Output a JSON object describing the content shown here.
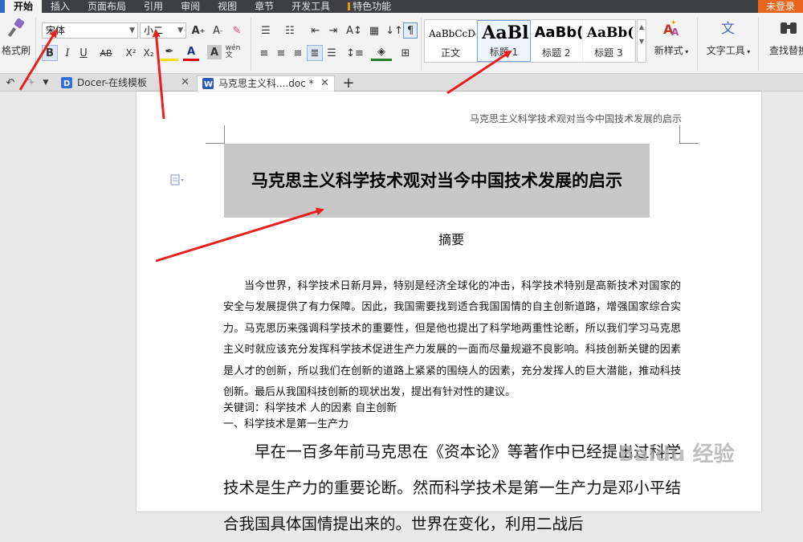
{
  "menubar": {
    "items": [
      "开始",
      "插入",
      "页面布局",
      "引用",
      "审阅",
      "视图",
      "章节",
      "开发工具",
      "特色功能"
    ],
    "login": "未登录"
  },
  "ribbon": {
    "format_painter": "格式刷",
    "font_name": "宋体",
    "font_size": "小二",
    "styles": [
      {
        "sample": "AaBbCcDd",
        "label": "正文"
      },
      {
        "sample": "AaBl",
        "label": "标题 1"
      },
      {
        "sample": "AaBb(",
        "label": "标题 2"
      },
      {
        "sample": "AaBb(",
        "label": "标题 3"
      }
    ],
    "new_style": "新样式",
    "text_tool": "文字工具",
    "find_replace": "查找替换"
  },
  "tabs": [
    {
      "label": "Docer-在线模板",
      "icon": "docer-icon"
    },
    {
      "label": "马克思主义科....doc *",
      "icon": "word-doc-icon"
    }
  ],
  "document": {
    "header": "马克思主义科学技术观对当今中国技术发展的启示",
    "title": "马克思主义科学技术观对当今中国技术发展的启示",
    "abstract_heading": "摘要",
    "abstract": "当今世界，科学技术日新月异，特别是经济全球化的冲击，科学技术特别是高新技术对国家的安全与发展提供了有力保障。因此，我国需要找到适合我国国情的自主创新道路，增强国家综合实力。马克思历来强调科学技术的重要性，但是他也提出了科学地两重性论断，所以我们学习马克思主义时就应该充分发挥科学技术促进生产力发展的一面而尽量规避不良影响。科技创新关键的因素是人才的创新，所以我们在创新的道路上紧紧的围绕人的因素，充分发挥人的巨大潜能，推动科技创新。最后从我国科技创新的现状出发，提出有针对性的建议。",
    "keywords": "关键词：科学技术  人的因素  自主创新",
    "section1": "一、科学技术是第一生产力",
    "body": "早在一百多年前马克思在《资本论》等著作中已经提出过科学技术是生产力的重要论断。然而科学技术是第一生产力是邓小平结合我国具体国情提出来的。世界在变化，利用二战后"
  },
  "watermark": "Baidu 经验",
  "colors": {
    "menubar_bg": "#3c3f44",
    "login_bg": "#e8651c",
    "annotation": "#e8201c",
    "title_highlight": "#c8c8c8"
  }
}
